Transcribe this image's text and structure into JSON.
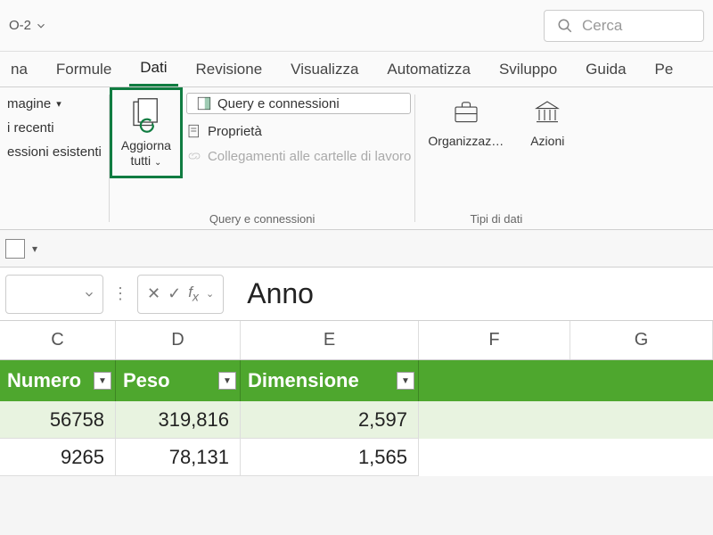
{
  "titlebar": {
    "doc_name": "O-2",
    "search_placeholder": "Cerca"
  },
  "tabs": [
    "na",
    "Formule",
    "Dati",
    "Revisione",
    "Visualizza",
    "Automatizza",
    "Sviluppo",
    "Guida",
    "Pe"
  ],
  "active_tab": "Dati",
  "ribbon": {
    "left_items": [
      "magine",
      "i recenti",
      "essioni esistenti"
    ],
    "refresh": {
      "label_l1": "Aggiorna",
      "label_l2": "tutti"
    },
    "query_items": {
      "connections": "Query e connessioni",
      "properties": "Proprietà",
      "links": "Collegamenti alle cartelle di lavoro"
    },
    "query_group_label": "Query e connessioni",
    "types": {
      "org": "Organizzaz…",
      "stocks": "Azioni",
      "group_label": "Tipi di dati"
    }
  },
  "formula_bar": {
    "cell_value": "Anno"
  },
  "columns": {
    "C": "C",
    "D": "D",
    "E": "E",
    "F": "F",
    "G": "G"
  },
  "table": {
    "headers": {
      "C": "Numero",
      "D": "Peso",
      "E": "Dimensione"
    },
    "rows": [
      {
        "C": "56758",
        "D": "319,816",
        "E": "2,597"
      },
      {
        "C": "9265",
        "D": "78,131",
        "E": "1,565"
      }
    ]
  },
  "chart_data": {
    "type": "table",
    "columns": [
      "Numero",
      "Peso",
      "Dimensione"
    ],
    "rows": [
      [
        56758,
        "319,816",
        "2,597"
      ],
      [
        9265,
        "78,131",
        "1,565"
      ]
    ]
  }
}
